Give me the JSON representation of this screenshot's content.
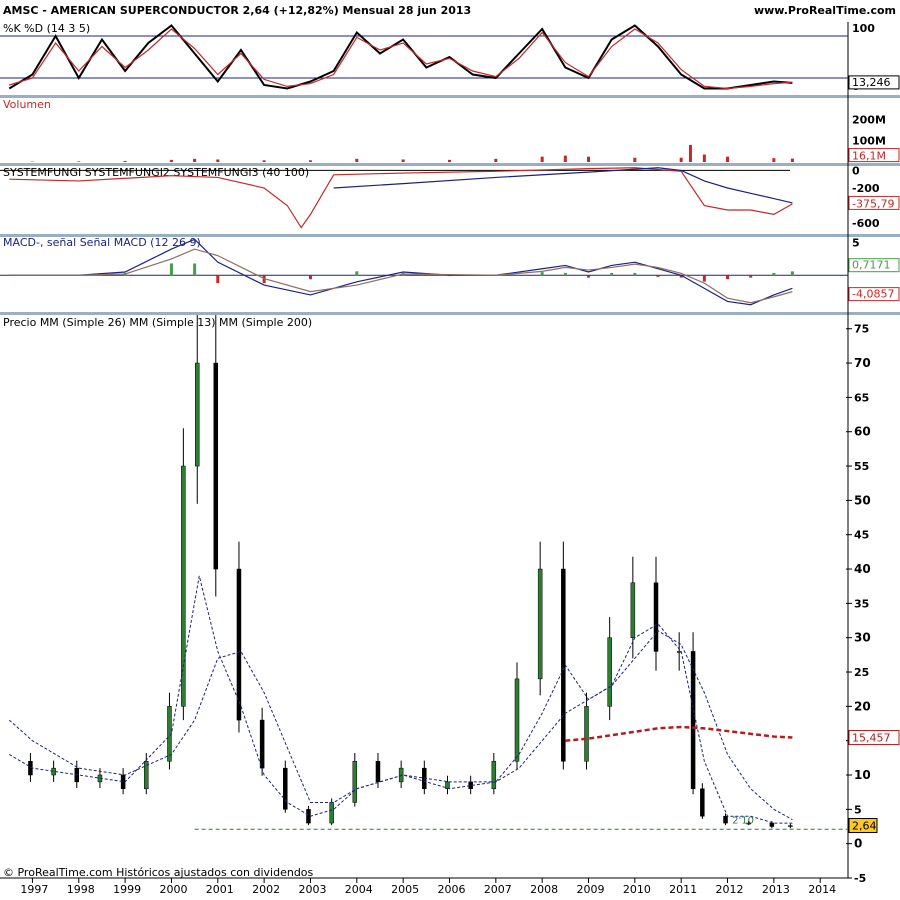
{
  "header": {
    "title": "AMSC - AMERICAN SUPERCONDUCTOR    2,64 (+12,82%)    Mensual  28 jun 2013",
    "site": "www.ProRealTime.com"
  },
  "footer": {
    "credit": "© ProRealTime.com  Históricos ajustados con dividendos"
  },
  "colors": {
    "separator": "#9aaec4",
    "up": "#2e7d32",
    "down": "#c62828",
    "mm26": "#1a237e",
    "mm13": "#1a237e",
    "mm200": "#b71c1c",
    "volume": "#c62828"
  },
  "chart_data": [
    {
      "type": "line",
      "title": "%K %D (14 3 5)",
      "yticks": [
        "100",
        "0"
      ],
      "ylim": [
        0,
        100
      ],
      "current_value": "13,246",
      "series": [
        {
          "name": "%K",
          "x": [
            1996.5,
            1997,
            1997.5,
            1998,
            1998.5,
            1999,
            1999.5,
            2000,
            2000.5,
            2001,
            2001.5,
            2002,
            2002.5,
            2003,
            2003.5,
            2004,
            2004.5,
            2005,
            2005.5,
            2006,
            2006.5,
            2007,
            2007.5,
            2008,
            2008.5,
            2009,
            2009.5,
            2010,
            2010.5,
            2011,
            2011.5,
            2012,
            2012.5,
            2013,
            2013.4
          ],
          "values": [
            5,
            25,
            80,
            20,
            75,
            30,
            70,
            95,
            55,
            15,
            60,
            10,
            5,
            15,
            30,
            85,
            55,
            75,
            35,
            50,
            25,
            20,
            55,
            90,
            35,
            20,
            75,
            95,
            65,
            25,
            5,
            5,
            10,
            15,
            13
          ]
        },
        {
          "name": "%D",
          "x": [
            1996.5,
            1997,
            1997.5,
            1998,
            1998.5,
            1999,
            1999.5,
            2000,
            2000.5,
            2001,
            2001.5,
            2002,
            2002.5,
            2003,
            2003.5,
            2004,
            2004.5,
            2005,
            2005.5,
            2006,
            2006.5,
            2007,
            2007.5,
            2008,
            2008.5,
            2009,
            2009.5,
            2010,
            2010.5,
            2011,
            2011.5,
            2012,
            2012.5,
            2013,
            2013.4
          ],
          "values": [
            10,
            20,
            70,
            30,
            65,
            35,
            60,
            90,
            62,
            25,
            55,
            18,
            8,
            12,
            25,
            78,
            60,
            70,
            40,
            48,
            30,
            22,
            48,
            85,
            42,
            22,
            65,
            90,
            70,
            32,
            8,
            5,
            8,
            12,
            14
          ]
        }
      ]
    },
    {
      "type": "bar",
      "title": "Volumen",
      "yticks": [
        "200M",
        "100M"
      ],
      "ylim": [
        0,
        300
      ],
      "current_value": "16,1M",
      "x": [
        1997,
        1998,
        1999,
        2000,
        2000.5,
        2001,
        2002,
        2003,
        2004,
        2005,
        2006,
        2007,
        2008,
        2008.5,
        2009,
        2010,
        2011,
        2011.2,
        2011.5,
        2012,
        2013,
        2013.4
      ],
      "values": [
        2,
        3,
        5,
        10,
        15,
        12,
        8,
        8,
        15,
        12,
        10,
        15,
        25,
        30,
        25,
        20,
        20,
        80,
        35,
        25,
        18,
        16
      ]
    },
    {
      "type": "line",
      "title": "SYSTEMFUNGI SYSTEMFUNGI2 SYSTEMFUNGI3 (40 100)",
      "yticks": [
        "0",
        "-200",
        "-600"
      ],
      "ylim": [
        -700,
        50
      ],
      "current_value": "-375,79",
      "series": [
        {
          "name": "SYSTEMFUNGI2",
          "x": [
            1996.5,
            1998,
            2000,
            2001,
            2002,
            2002.5,
            2002.8,
            2003,
            2003.5,
            2005,
            2007,
            2009,
            2010,
            2011,
            2011.5,
            2012,
            2012.5,
            2013,
            2013.4
          ],
          "values": [
            -100,
            -120,
            -60,
            -80,
            -200,
            -400,
            -650,
            -500,
            -50,
            -30,
            -10,
            20,
            30,
            -10,
            -400,
            -450,
            -450,
            -500,
            -380
          ]
        },
        {
          "name": "SYSTEMFUNGI3",
          "x": [
            2003.5,
            2005,
            2007,
            2009,
            2010.5,
            2011,
            2011.5,
            2012,
            2012.5,
            2013,
            2013.4
          ],
          "values": [
            -200,
            -150,
            -80,
            -20,
            30,
            0,
            -120,
            -200,
            -260,
            -320,
            -370
          ]
        }
      ]
    },
    {
      "type": "line",
      "title": "MACD-, señal Señal MACD (12 26 9)",
      "yticks": [
        "5",
        "0"
      ],
      "ylim": [
        -5,
        6
      ],
      "current_values": [
        "0,7171",
        "-4,0857"
      ],
      "series": [
        {
          "name": "MACD",
          "x": [
            1996.5,
            1998,
            1999,
            2000,
            2000.5,
            2001,
            2002,
            2003,
            2004,
            2005,
            2006,
            2007,
            2008,
            2008.5,
            2009,
            2009.5,
            2010,
            2010.5,
            2011,
            2011.5,
            2012,
            2012.5,
            2013,
            2013.4
          ],
          "values": [
            0,
            0,
            0.5,
            4,
            5.5,
            2,
            -1.5,
            -3,
            -1,
            0.5,
            0,
            0,
            1,
            1.5,
            0.5,
            1.5,
            2,
            1,
            0,
            -2,
            -4,
            -4.5,
            -3,
            -2
          ]
        },
        {
          "name": "Señal",
          "x": [
            1996.5,
            1998,
            1999,
            2000,
            2000.5,
            2001,
            2002,
            2003,
            2004,
            2005,
            2006,
            2007,
            2008,
            2008.5,
            2009,
            2009.5,
            2010,
            2010.5,
            2011,
            2011.5,
            2012,
            2012.5,
            2013,
            2013.4
          ],
          "values": [
            0,
            0,
            0.2,
            2.5,
            4,
            3,
            -0.5,
            -2.5,
            -1.5,
            0.2,
            0.1,
            0,
            0.6,
            1.2,
            0.8,
            1.2,
            1.7,
            1.2,
            0.3,
            -1.2,
            -3.5,
            -4.2,
            -3.3,
            -2.5
          ]
        }
      ]
    },
    {
      "type": "line",
      "title": "Precio MM (Simple 26) MM (Simple 13) MM (Simple 200)",
      "yticks": [
        "75",
        "70",
        "65",
        "60",
        "55",
        "50",
        "45",
        "40",
        "35",
        "30",
        "25",
        "20",
        "15",
        "10",
        "5",
        "0",
        "-5"
      ],
      "ylim": [
        -5,
        77
      ],
      "xticks": [
        "1997",
        "1998",
        "1999",
        "2000",
        "2001",
        "2002",
        "2003",
        "2004",
        "2005",
        "2006",
        "2007",
        "2008",
        "2009",
        "2010",
        "2011",
        "2012",
        "2013",
        "2014"
      ],
      "xlim": [
        1996.3,
        2014.6
      ],
      "current_values": [
        "15,457",
        "2,64"
      ],
      "annotation": "2'10",
      "support_level": 2.1,
      "series": [
        {
          "name": "Precio",
          "x": [
            1996.5,
            1997,
            1997.5,
            1998,
            1998.5,
            1999,
            1999.5,
            2000,
            2000.3,
            2000.6,
            2001,
            2001.5,
            2002,
            2002.5,
            2003,
            2003.5,
            2004,
            2004.5,
            2005,
            2005.5,
            2006,
            2006.5,
            2007,
            2007.5,
            2008,
            2008.5,
            2009,
            2009.5,
            2010,
            2010.5,
            2011,
            2011.3,
            2011.5,
            2012,
            2012.5,
            2013,
            2013.4
          ],
          "values": [
            12,
            10,
            11,
            9,
            10,
            8,
            12,
            20,
            55,
            70,
            40,
            18,
            11,
            5,
            3,
            6,
            12,
            9,
            11,
            8,
            9,
            8,
            12,
            24,
            40,
            12,
            20,
            30,
            38,
            28,
            28,
            8,
            4,
            3,
            3,
            2.5,
            2.64
          ]
        },
        {
          "name": "MM (Simple 13)",
          "x": [
            1996.5,
            1997,
            1998,
            1999,
            2000,
            2000.6,
            2001,
            2001.5,
            2002,
            2002.5,
            2003,
            2003.5,
            2004,
            2005,
            2006,
            2007,
            2007.5,
            2008,
            2008.5,
            2009,
            2009.5,
            2010,
            2010.5,
            2011,
            2011.5,
            2012,
            2012.5,
            2013,
            2013.4
          ],
          "values": [
            13,
            11,
            10,
            9,
            16,
            39,
            28,
            20,
            10,
            6,
            4,
            5,
            8,
            10,
            8,
            9,
            13,
            19,
            26,
            21,
            23,
            30,
            32,
            28,
            12,
            4,
            4,
            3,
            3
          ]
        },
        {
          "name": "MM (Simple 26)",
          "x": [
            1996.5,
            1997,
            1998,
            1999,
            2000,
            2000.5,
            2001,
            2001.5,
            2002,
            2002.5,
            2003,
            2003.5,
            2004,
            2005,
            2006,
            2007,
            2007.5,
            2008,
            2008.5,
            2009,
            2009.5,
            2010,
            2010.5,
            2011,
            2011.5,
            2012,
            2012.5,
            2013,
            2013.4
          ],
          "values": [
            18,
            15,
            11,
            10,
            13,
            18,
            27,
            28,
            22,
            14,
            6,
            6,
            8,
            10,
            9,
            9,
            11,
            15,
            19,
            21,
            23,
            27,
            31,
            29,
            22,
            13,
            8,
            5,
            3.5
          ]
        },
        {
          "name": "MM (Simple 200)",
          "x": [
            2008.5,
            2009,
            2009.5,
            2010,
            2010.5,
            2011,
            2011.5,
            2012,
            2012.5,
            2013,
            2013.4
          ],
          "values": [
            15,
            15.3,
            15.8,
            16.3,
            16.8,
            17,
            16.8,
            16.4,
            16,
            15.6,
            15.457
          ]
        }
      ]
    }
  ]
}
